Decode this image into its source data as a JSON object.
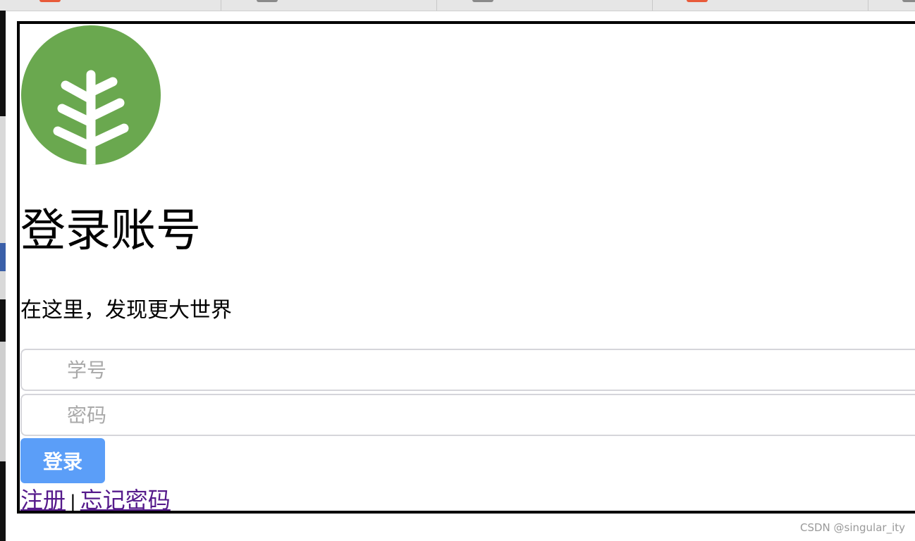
{
  "colors": {
    "logo_green": "#6aa84f",
    "button_blue": "#5b9ef8",
    "visited_link": "#551a8b",
    "tab_favicon_red": "#e85b3a",
    "tab_favicon_gray": "#8a8a8a"
  },
  "logo": {
    "icon": "tree-icon"
  },
  "login": {
    "title": "登录账号",
    "subtitle": "在这里，发现更大世界",
    "student_id_placeholder": "学号",
    "password_placeholder": "密码",
    "login_button": "登录",
    "register_link": "注册",
    "separator": "|",
    "forgot_link": "忘记密码"
  },
  "watermark": "CSDN @singular_ity"
}
